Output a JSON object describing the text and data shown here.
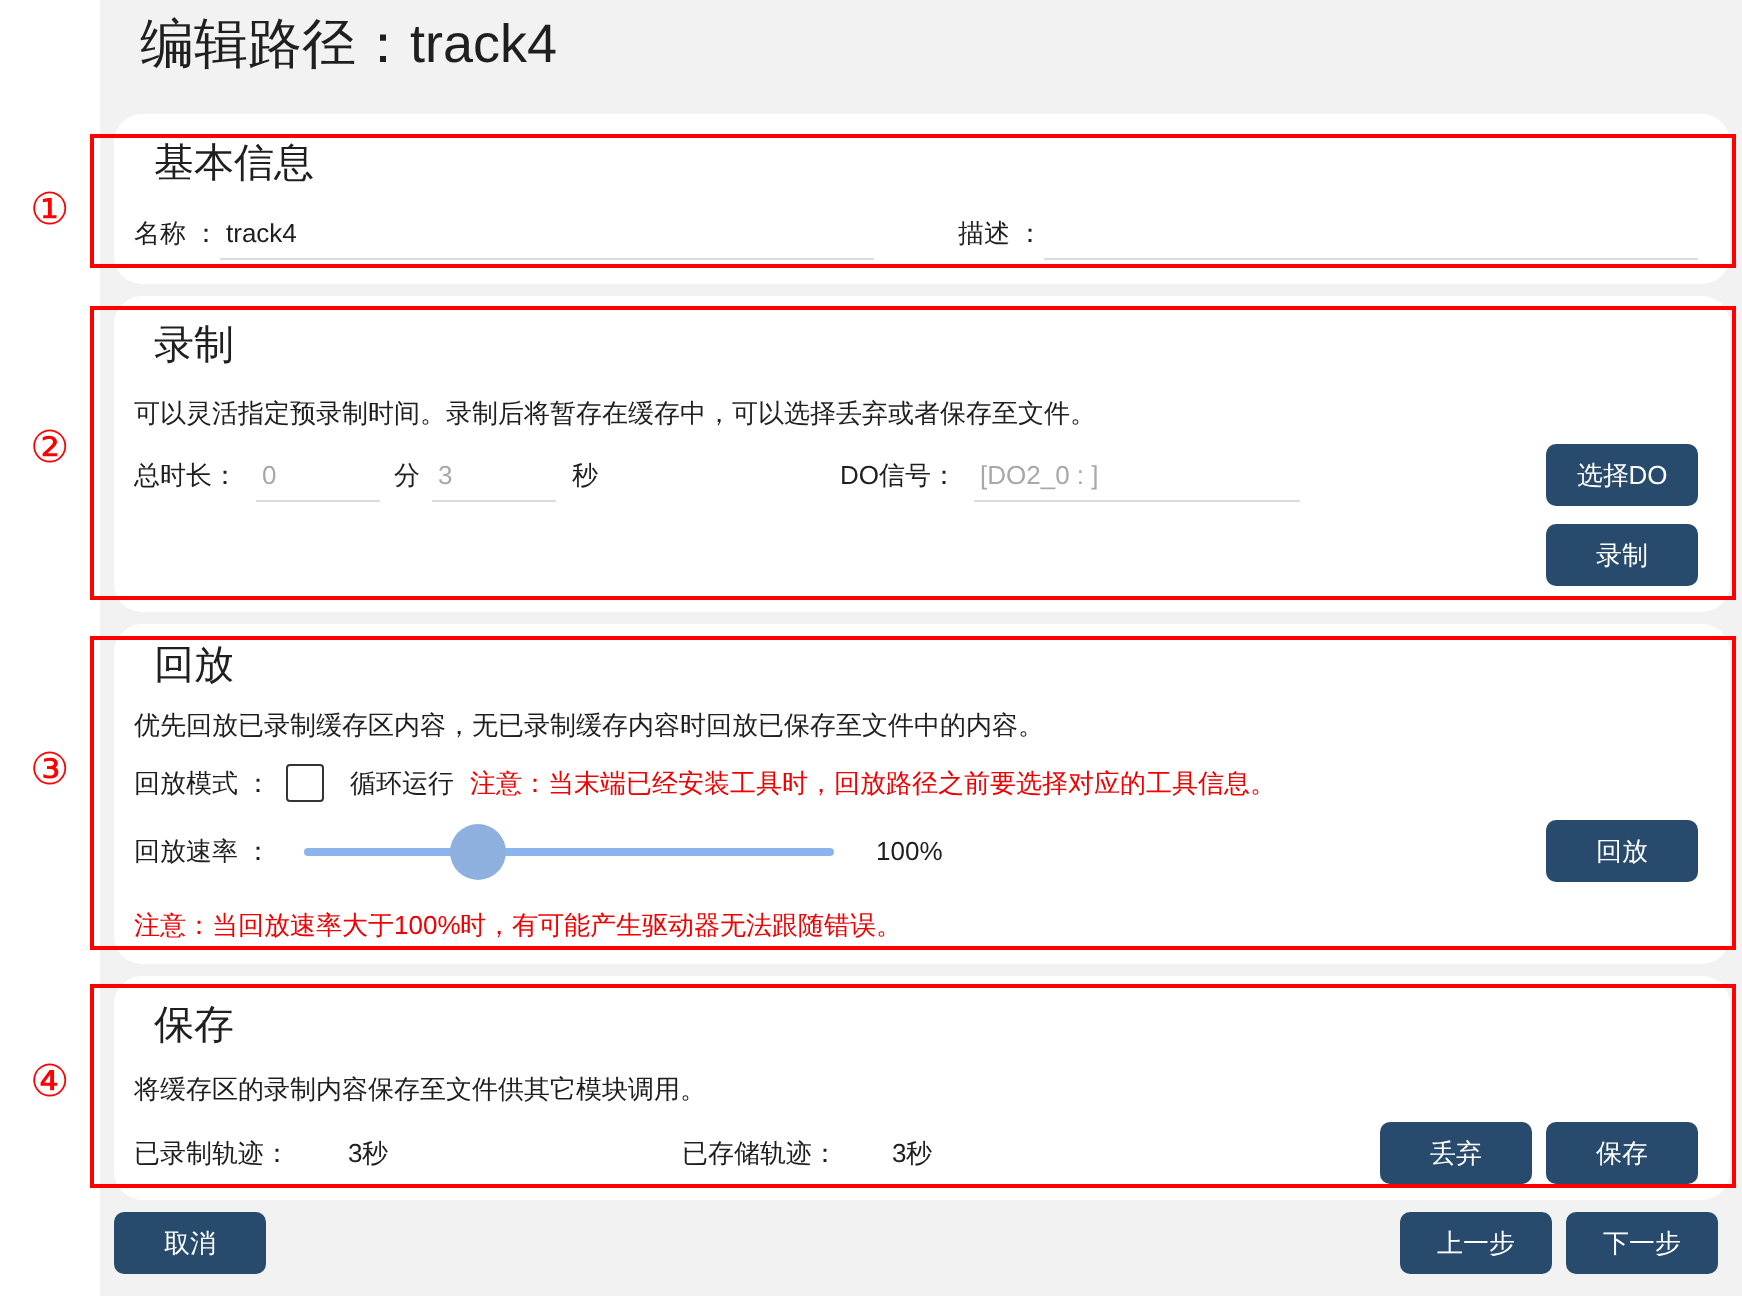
{
  "title": "编辑路径：track4",
  "basic_info": {
    "marker": "①",
    "heading": "基本信息",
    "name": {
      "label": "名称 ：",
      "value": "track4"
    },
    "description": {
      "label": "描述 ："
    }
  },
  "recording": {
    "marker": "②",
    "heading": "录制",
    "description": "可以灵活指定预录制时间。录制后将暂存在缓存中，可以选择丢弃或者保存至文件。",
    "duration": {
      "label": "总时长：",
      "minutes": {
        "placeholder": "0",
        "unit": "分"
      },
      "seconds": {
        "placeholder": "3",
        "unit": "秒"
      }
    },
    "do_signal": {
      "label": "DO信号：",
      "placeholder": "[DO2_0 : ]"
    },
    "buttons": [
      "选择DO",
      "录制"
    ]
  },
  "playback": {
    "marker": "③",
    "heading": "回放",
    "description": "优先回放已录制缓存区内容，无已录制缓存内容时回放已保存至文件中的内容。",
    "mode": {
      "label": "回放模式 ：",
      "loop": {
        "label": "循环运行",
        "checked": false
      },
      "note": "注意：当末端已经安装工具时，回放路径之前要选择对应的工具信息。"
    },
    "speed": {
      "label": "回放速率 ：",
      "level": 0.33,
      "reading": "100%"
    },
    "button": "回放",
    "note": "注意：当回放速率大于100%时，有可能产生驱动器无法跟随错误。"
  },
  "save": {
    "marker": "④",
    "heading": "保存",
    "description": "将缓存区的录制内容保存至文件供其它模块调用。",
    "recorded": {
      "label": "已录制轨迹：",
      "value": "3秒"
    },
    "stored": {
      "label": "已存储轨迹：",
      "value": "3秒"
    },
    "buttons": [
      "丢弃",
      "保存"
    ]
  },
  "footer": {
    "cancel": "取消",
    "previous": "上一步",
    "next": "下一步"
  }
}
